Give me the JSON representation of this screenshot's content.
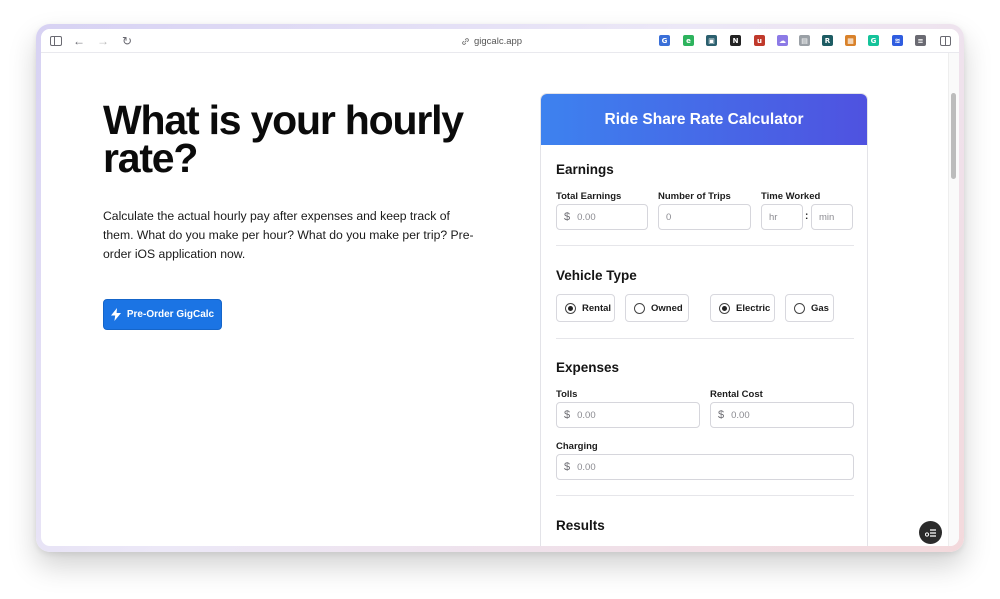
{
  "browser": {
    "url": "gigcalc.app",
    "extensions": [
      {
        "name": "translate-icon",
        "glyph": "G",
        "color": "#3a6fd8"
      },
      {
        "name": "evernote-icon",
        "glyph": "e",
        "color": "#2db35d"
      },
      {
        "name": "photo-icon",
        "glyph": "▣",
        "color": "#2b5f6e"
      },
      {
        "name": "notion-icon",
        "glyph": "N",
        "color": "#222222"
      },
      {
        "name": "shield-ext-icon",
        "glyph": "u",
        "color": "#c0392b"
      },
      {
        "name": "cloud-ext-icon",
        "glyph": "☁",
        "color": "#8c7ae6"
      },
      {
        "name": "page-ext-icon",
        "glyph": "▤",
        "color": "#9aa0a6"
      },
      {
        "name": "r-ext-icon",
        "glyph": "R",
        "color": "#1d5c63"
      },
      {
        "name": "box-ext-icon",
        "glyph": "▦",
        "color": "#d9822b"
      },
      {
        "name": "grammarly-icon",
        "glyph": "G",
        "color": "#15c39a"
      },
      {
        "name": "audio-ext-icon",
        "glyph": "≋",
        "color": "#2f5de0"
      },
      {
        "name": "notes-ext-icon",
        "glyph": "≡",
        "color": "#6a6a72"
      }
    ]
  },
  "hero": {
    "title": "What is your hourly rate?",
    "description": "Calculate the actual hourly pay after expenses and keep track of them. What do you make per hour? What do you make per trip? Pre-order iOS application now.",
    "cta_label": "Pre-Order GigCalc"
  },
  "calculator": {
    "title": "Ride Share Rate Calculator",
    "earnings": {
      "heading": "Earnings",
      "total_label": "Total Earnings",
      "total_placeholder": "0.00",
      "trips_label": "Number of Trips",
      "trips_placeholder": "0",
      "time_label": "Time Worked",
      "hr_placeholder": "hr",
      "min_placeholder": "min",
      "separator": ":"
    },
    "vehicle": {
      "heading": "Vehicle Type",
      "options": [
        {
          "label": "Rental",
          "selected": true
        },
        {
          "label": "Owned",
          "selected": false
        },
        {
          "label": "Electric",
          "selected": true
        },
        {
          "label": "Gas",
          "selected": false
        }
      ]
    },
    "expenses": {
      "heading": "Expenses",
      "tolls_label": "Tolls",
      "tolls_placeholder": "0.00",
      "rental_label": "Rental Cost",
      "rental_placeholder": "0.00",
      "charging_label": "Charging",
      "charging_placeholder": "0.00"
    },
    "results": {
      "heading": "Results"
    },
    "currency_symbol": "$"
  }
}
